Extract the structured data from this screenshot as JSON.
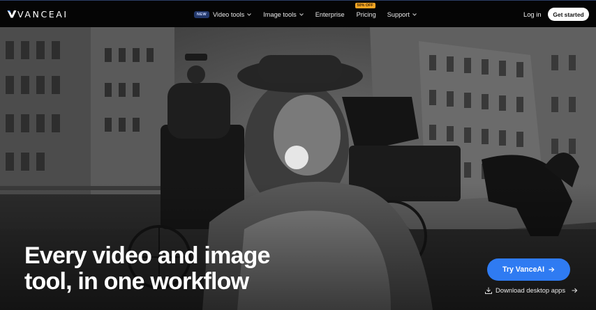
{
  "brand": {
    "name": "VANCEAI"
  },
  "nav": {
    "items": [
      {
        "label": "Video tools",
        "badge": "NEW",
        "has_dropdown": true
      },
      {
        "label": "Image tools",
        "has_dropdown": true
      },
      {
        "label": "Enterprise",
        "has_dropdown": false
      },
      {
        "label": "Pricing",
        "badge": "50% OFF",
        "has_dropdown": false
      },
      {
        "label": "Support",
        "has_dropdown": true
      }
    ],
    "login_label": "Log in",
    "cta_label": "Get started"
  },
  "hero": {
    "headline_line1": "Every video and image",
    "headline_line2": "tool, in one workflow",
    "primary_cta": "Try VanceAI",
    "secondary_link": "Download desktop apps",
    "image": "black-and-white historic street scene with horse carriage"
  },
  "colors": {
    "nav_bg": "#050505",
    "accent_blue": "#2f7bf2",
    "badge_orange": "#f5a524",
    "badge_new_bg": "#23386b"
  }
}
